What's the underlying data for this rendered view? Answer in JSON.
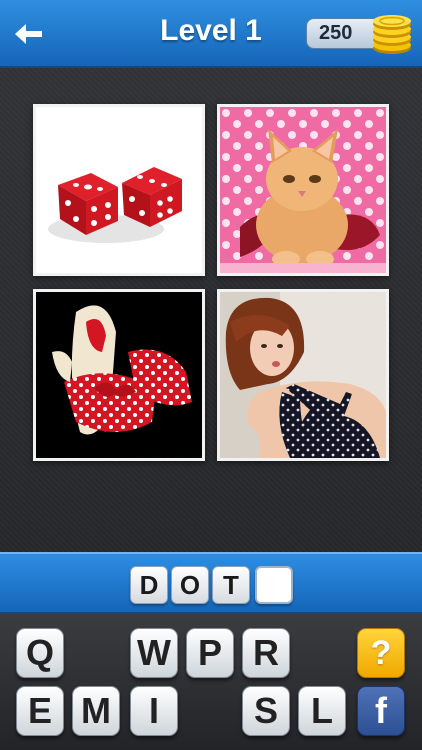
{
  "header": {
    "title": "Level 1",
    "coins": "250"
  },
  "tiles": [
    {
      "name": "dice-image"
    },
    {
      "name": "kitten-image"
    },
    {
      "name": "polka-dot-slippers-image"
    },
    {
      "name": "woman-polka-dot-dress-image"
    }
  ],
  "answer": {
    "letters": [
      "D",
      "O",
      "T",
      ""
    ]
  },
  "keyboard": {
    "row1": [
      "Q",
      "W",
      "P",
      "R"
    ],
    "row2": [
      "E",
      "M",
      "I",
      "S",
      "L"
    ],
    "hint_label": "?",
    "facebook_label": "f"
  },
  "colors": {
    "accent_blue": "#1e78cf",
    "hint_yellow": "#f6b800",
    "facebook_blue": "#3b5998"
  }
}
